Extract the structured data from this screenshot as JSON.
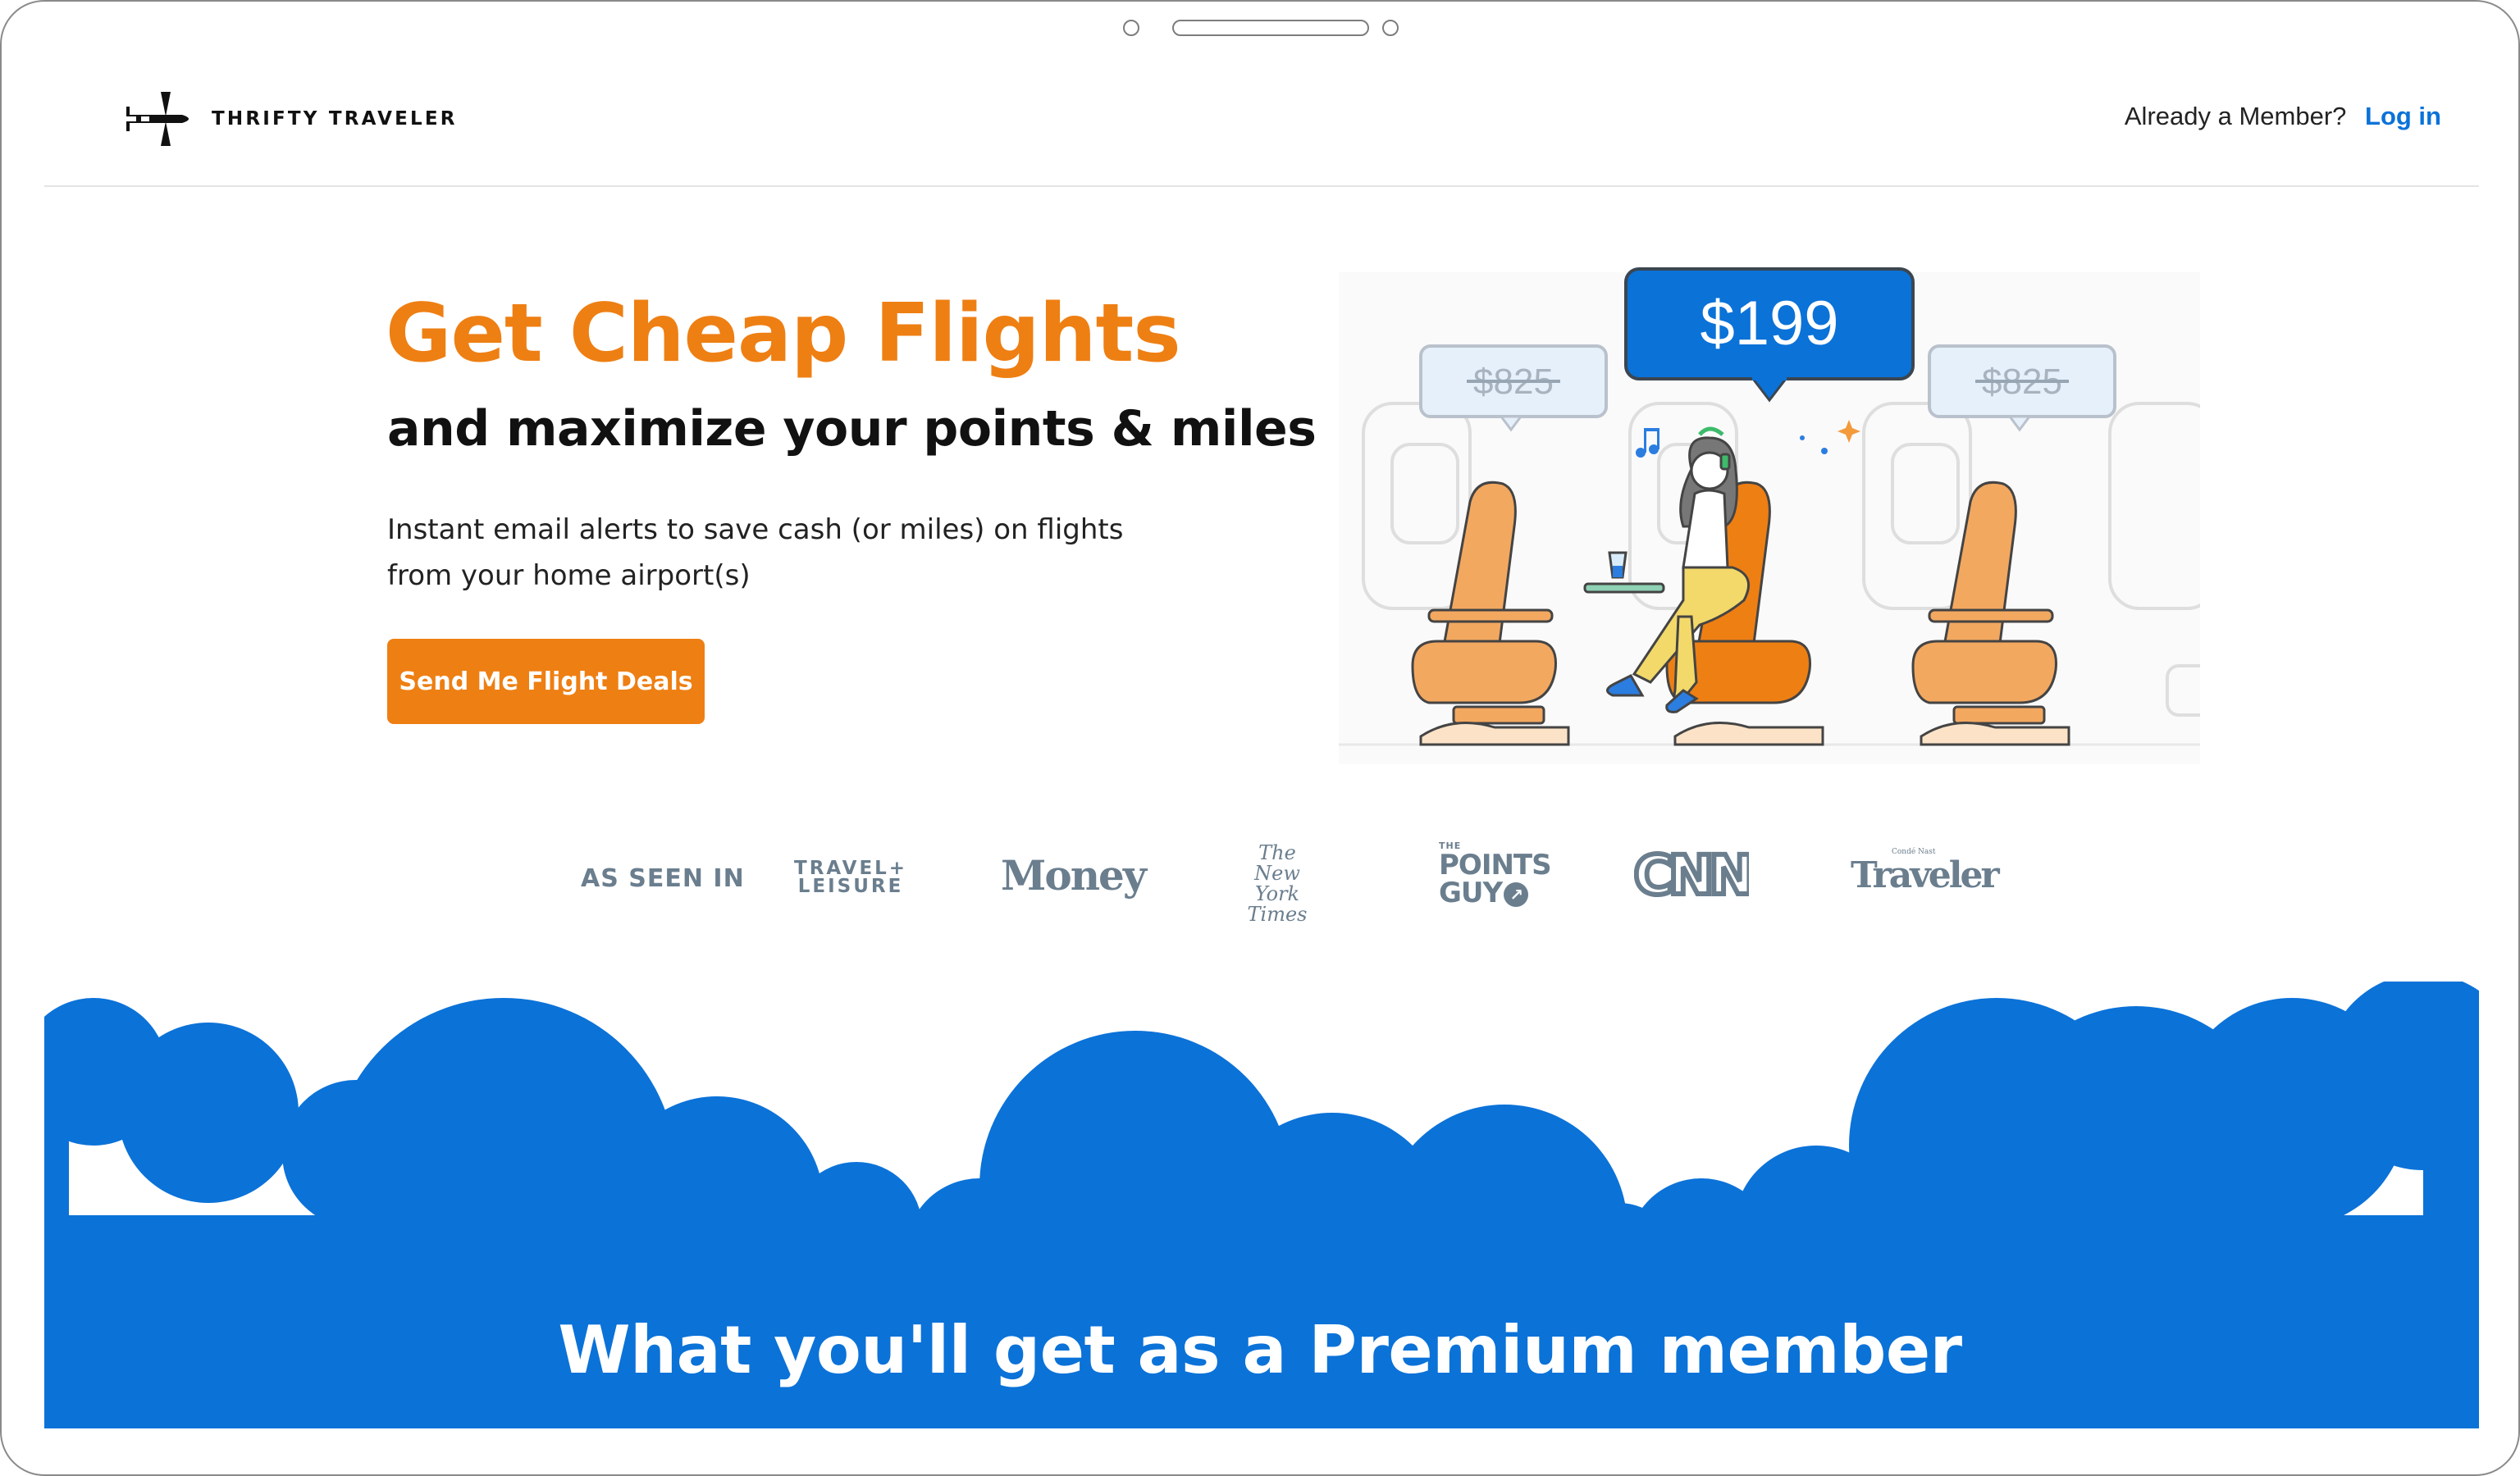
{
  "brand": {
    "name": "THRIFTY TRAVELER"
  },
  "header": {
    "member_prompt": "Already a Member?",
    "login_label": "Log in"
  },
  "hero": {
    "title": "Get Cheap Flights",
    "subtitle": "and maximize your points & miles",
    "description_line1": "Instant email alerts to save cash (or miles) on flights",
    "description_line2": "from your home airport(s)",
    "cta_label": "Send Me Flight Deals"
  },
  "illustration": {
    "deal_price": "$199",
    "old_price_left": "$825",
    "old_price_right": "$825"
  },
  "press": {
    "label": "AS SEEN IN",
    "logos": [
      {
        "name": "travel-leisure",
        "line1": "TRAVEL+",
        "line2": "LEISURE"
      },
      {
        "name": "money",
        "text": "Money"
      },
      {
        "name": "nyt",
        "line1": "The",
        "line2": "New York",
        "line3": "Times"
      },
      {
        "name": "points-guy",
        "small": "THE",
        "line1": "POINTS",
        "line2": "GUY"
      },
      {
        "name": "cnn",
        "text": "CNN"
      },
      {
        "name": "traveler",
        "small": "Condé Nast",
        "text": "Traveler"
      }
    ]
  },
  "premium": {
    "title": "What you'll get as a Premium member"
  },
  "colors": {
    "accent": "#ee7f13",
    "primary_blue": "#0b72d8",
    "text_dark": "#111111",
    "press_gray": "#6a7e8e"
  }
}
